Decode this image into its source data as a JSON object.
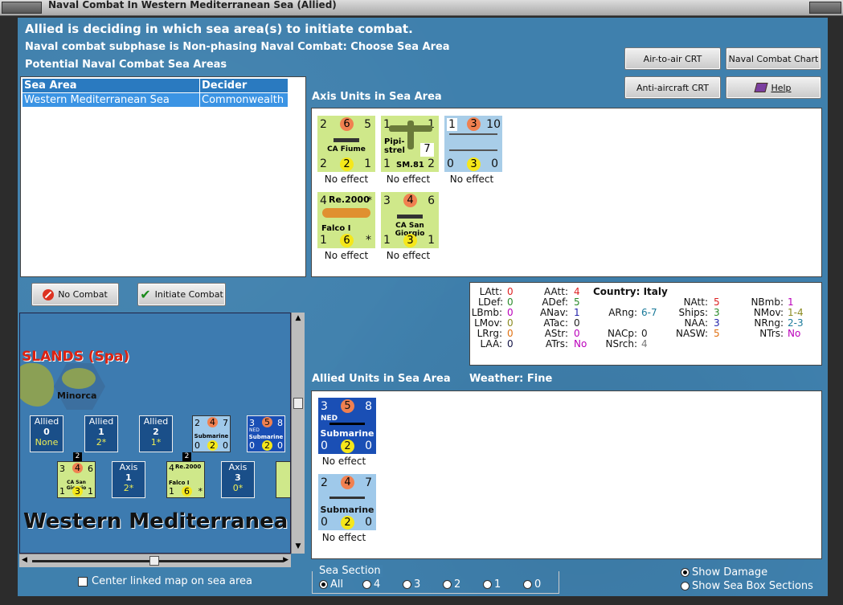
{
  "window": {
    "title": "Naval Combat In Western Mediterranean Sea (Allied)"
  },
  "header": {
    "line1": "Allied is deciding in which sea area(s) to initiate combat.",
    "line2": "Naval combat subphase is Non-phasing Naval Combat: Choose Sea Area",
    "line3": "Potential Naval Combat Sea Areas"
  },
  "buttons": {
    "air_to_air": "Air-to-air CRT",
    "naval_chart": "Naval Combat Chart",
    "anti_aircraft": "Anti-aircraft CRT",
    "help": "Help",
    "no_combat": "No Combat",
    "initiate_combat": "Initiate Combat"
  },
  "sea_table": {
    "headers": [
      "Sea Area",
      "Decider"
    ],
    "rows": [
      [
        "Western Mediterranean Sea",
        "Commonwealth"
      ]
    ]
  },
  "axis": {
    "title": "Axis Units in Sea Area",
    "units": [
      {
        "tl": "2",
        "tc": "6",
        "tr": "5",
        "name": "CA Fiume",
        "bl": "2",
        "bc": "2",
        "br": "1",
        "effect": "No effect"
      },
      {
        "tl": "1",
        "tr": "1",
        "name1": "Pipi-",
        "name2": "strel",
        "badge": "7",
        "name": "SM.81",
        "bl": "1",
        "br": "2",
        "effect": "No effect"
      },
      {
        "tl": "1",
        "tc": "3",
        "tr": "10",
        "bl": "0",
        "bc": "3",
        "br": "0",
        "effect": "No effect"
      },
      {
        "tl": "4",
        "type": "Re.2000",
        "star": "*",
        "name": "Falco I",
        "bl": "1",
        "bc": "6",
        "br": "*",
        "effect": "No effect"
      },
      {
        "tl": "3",
        "tc": "4",
        "tr": "6",
        "name": "CA San Giorgio",
        "bl": "1",
        "bc": "3",
        "br": "1",
        "effect": "No effect"
      }
    ]
  },
  "stats": {
    "col1": [
      [
        "LAtt:",
        "0"
      ],
      [
        "LDef:",
        "0"
      ],
      [
        "LBmb:",
        "0"
      ],
      [
        "LMov:",
        "0"
      ],
      [
        "LRrg:",
        "0"
      ],
      [
        "LAA:",
        "0"
      ]
    ],
    "col2": [
      [
        "AAtt:",
        "4"
      ],
      [
        "ADef:",
        "5"
      ],
      [
        "ANav:",
        "1"
      ],
      [
        "ATac:",
        "0"
      ],
      [
        "AStr:",
        "0"
      ],
      [
        "ATrs:",
        "No"
      ]
    ],
    "country": "Country: Italy",
    "col3": [
      [
        "ARng:",
        "6-7"
      ],
      [
        "NACp:",
        "0"
      ],
      [
        "NSrch:",
        "4"
      ]
    ],
    "col4": [
      [
        "NAtt:",
        "5"
      ],
      [
        "Ships:",
        "3"
      ],
      [
        "NAA:",
        "3"
      ],
      [
        "NASW:",
        "5"
      ]
    ],
    "col5": [
      [
        "NBmb:",
        "1"
      ],
      [
        "NMov:",
        "1-4"
      ],
      [
        "NRng:",
        "2-3"
      ],
      [
        "NTrs:",
        "No"
      ]
    ]
  },
  "allied": {
    "title": "Allied Units in Sea Area",
    "weather": "Weather:  Fine",
    "units": [
      {
        "tl": "3",
        "tc": "5",
        "tr": "8",
        "nation": "NED",
        "name": "Submarine",
        "bl": "0",
        "bc": "2",
        "br": "0",
        "effect": "No effect"
      },
      {
        "tl": "2",
        "tc": "4",
        "tr": "7",
        "name": "Submarine",
        "bl": "0",
        "bc": "2",
        "br": "0",
        "effect": "No effect"
      }
    ]
  },
  "map": {
    "region": "SLANDS (Spa)",
    "island": "Minorca",
    "sea_name": "Western Mediterranea",
    "boxes": [
      {
        "side": "Allied",
        "num": "0",
        "val": "None"
      },
      {
        "side": "Allied",
        "num": "1",
        "val": "2*"
      },
      {
        "side": "Allied",
        "num": "2",
        "val": "1*"
      },
      {
        "side": "Axis",
        "num": "1",
        "val": "2*"
      },
      {
        "side": "Axis",
        "num": "3",
        "val": "0*"
      }
    ],
    "mini": {
      "sub1": {
        "t": [
          "2",
          "4",
          "7"
        ],
        "name": "Submarine",
        "b": [
          "0",
          "2",
          "0"
        ]
      },
      "sub2": {
        "t": [
          "3",
          "5",
          "8"
        ],
        "nation": "NED",
        "name": "Submarine",
        "b": [
          "0",
          "2",
          "0"
        ]
      },
      "ca": {
        "t": [
          "3",
          "4",
          "6"
        ],
        "name": "CA San Giorgio",
        "b": [
          "1",
          "3",
          "1"
        ],
        "stack": "2"
      },
      "re": {
        "tl": "4",
        "type": "Re.2000",
        "name": "Falco I",
        "b": [
          "1",
          "6",
          "*"
        ],
        "stack": "2"
      }
    }
  },
  "options": {
    "center_map": "Center linked map on sea area",
    "sea_section_title": "Sea Section",
    "sea_sections": [
      "All",
      "4",
      "3",
      "2",
      "1",
      "0"
    ],
    "show_damage": "Show Damage",
    "show_sea_box": "Show Sea Box Sections"
  },
  "colors": {
    "accent": "#3b94e4",
    "axis_counter": "#cfe88a",
    "allied_counter": "#9fc9ea",
    "ned_counter": "#1a4fb5",
    "attack_circle": "#f08050",
    "defense_circle": "#f5e71a"
  }
}
